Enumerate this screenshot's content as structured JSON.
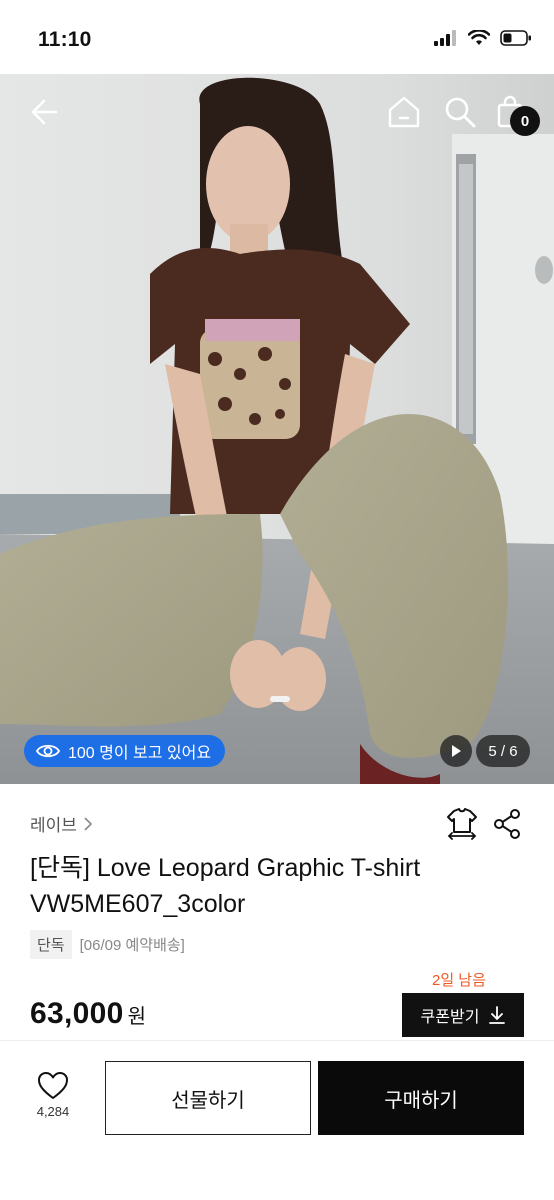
{
  "status_bar": {
    "time": "11:10"
  },
  "nav": {
    "bag_count": "0"
  },
  "hero": {
    "viewers_text": "100 명이 보고 있어요",
    "page_indicator": "5 / 6"
  },
  "product": {
    "brand": "레이브",
    "title": "[단독] Love Leopard Graphic T-shirt VW5ME607_3color",
    "tag_exclusive": "단독",
    "tag_date": "[06/09 예약배송]",
    "days_left": "2일 남음",
    "price": "63,000",
    "price_unit": "원",
    "coupon_label": "쿠폰받기"
  },
  "bottom_bar": {
    "like_count": "4,284",
    "gift_label": "선물하기",
    "buy_label": "구매하기"
  },
  "colors": {
    "accent_blue": "#1e6fe6",
    "days_left_orange": "#ee5a24",
    "black": "#0a0a0a"
  }
}
